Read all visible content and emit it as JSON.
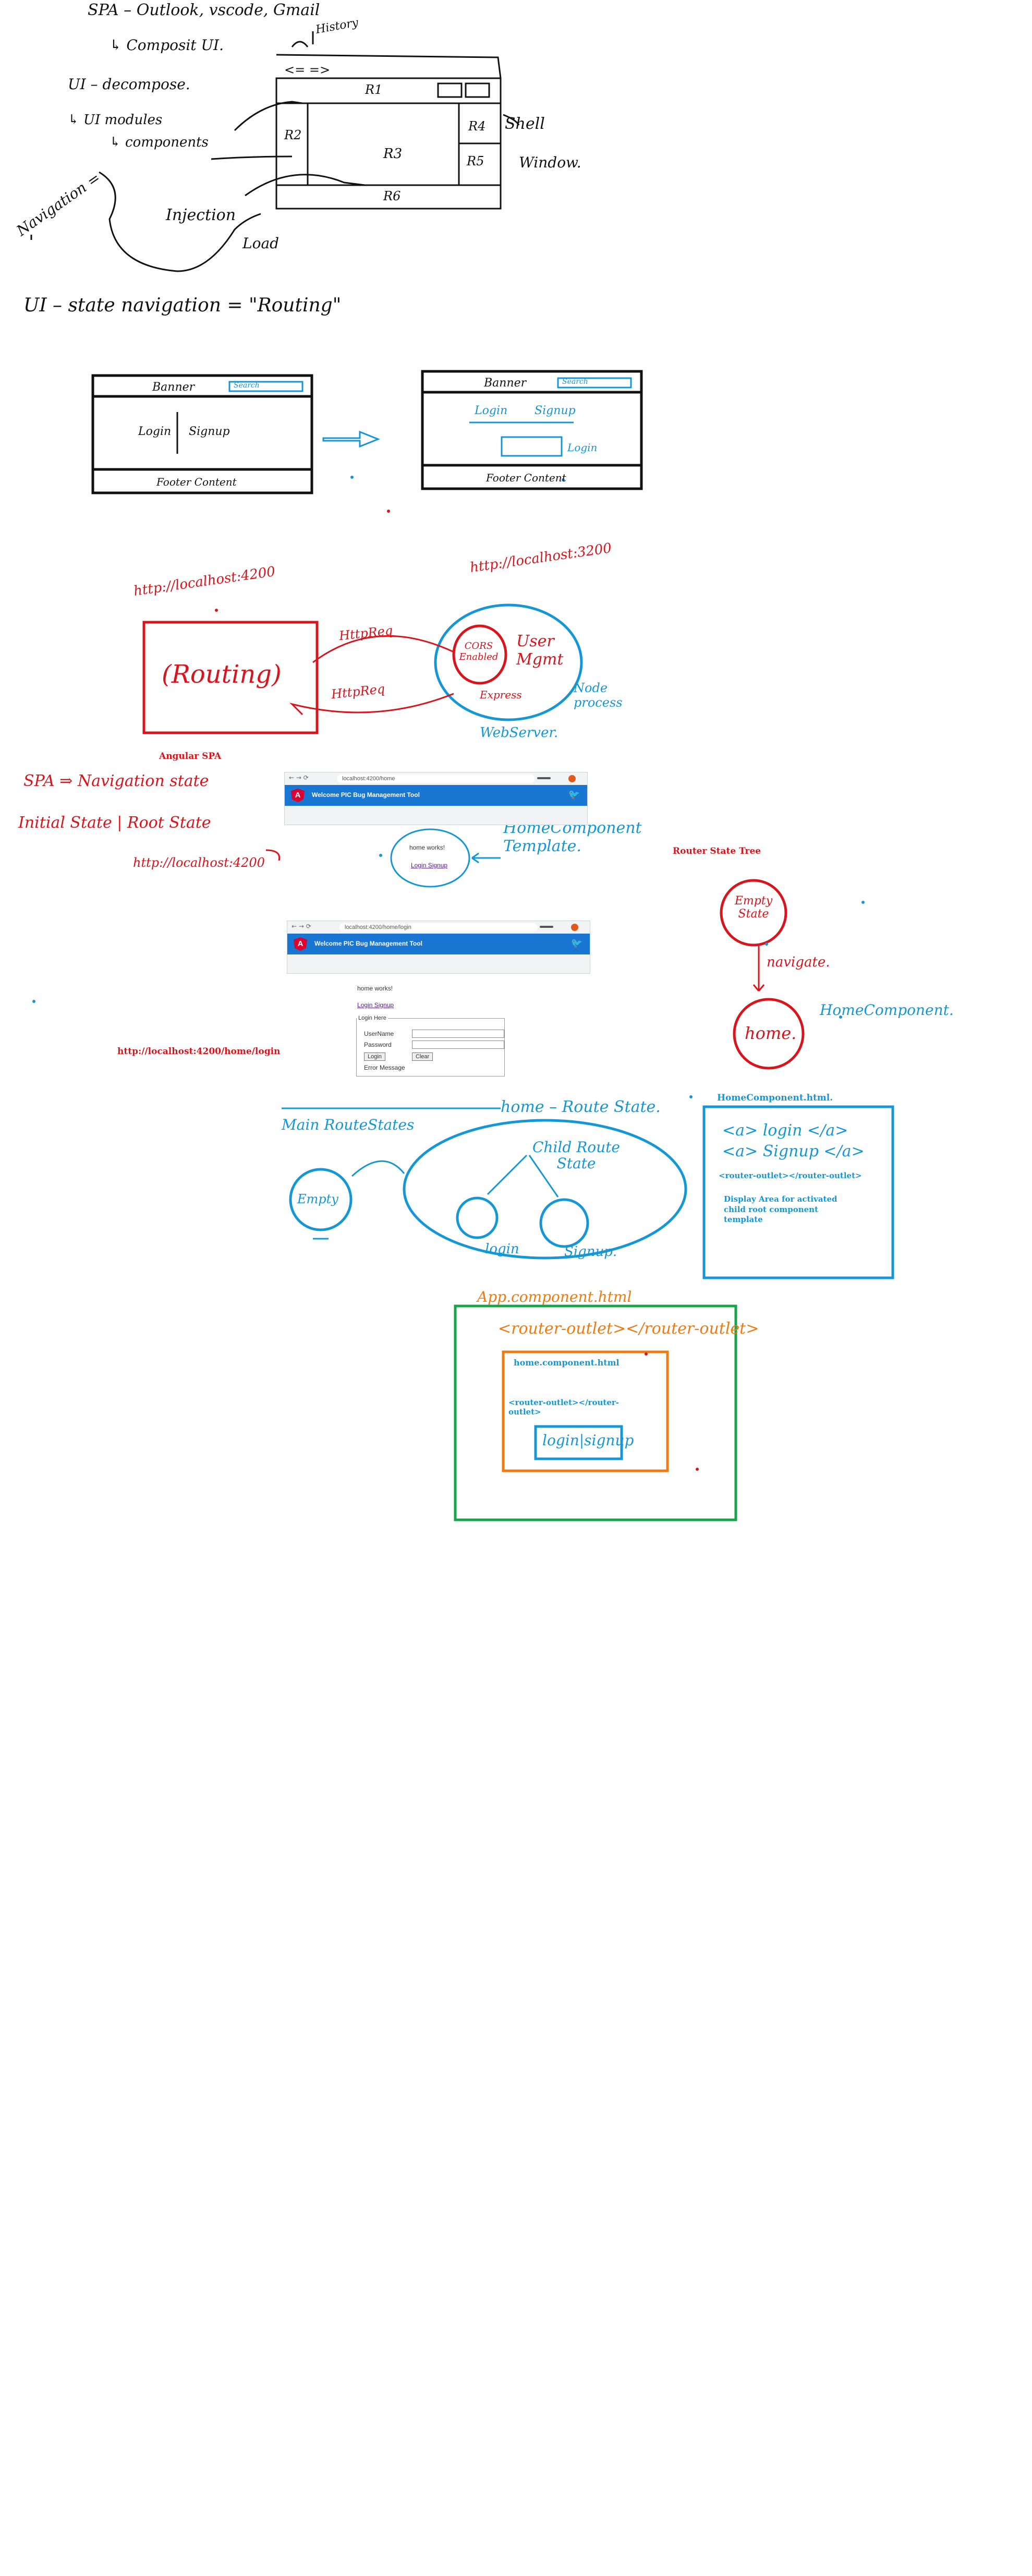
{
  "notes": {
    "spa_line": "SPA – Outlook, vscode, Gmail",
    "composite_ui": "↳ Composit UI.",
    "ui_decompose": "UI – decompose.",
    "ui_modules": "↳ UI modules",
    "components": "↳ components",
    "navigation": "Navigation =",
    "injection": "Injection",
    "load": "Load",
    "history": "History",
    "arrows": "<= =>",
    "shell": "Shell",
    "window": "Window.",
    "ui_state": "UI – state navigation = \"Routing\""
  },
  "shell_regions": {
    "r1": "R1",
    "r2": "R2",
    "r3": "R3",
    "r4": "R4",
    "r5": "R5",
    "r6": "R6"
  },
  "mockups": {
    "banner": "Banner",
    "search": "Search",
    "login": "Login",
    "signup": "Signup",
    "footer": "Footer Content"
  },
  "routing": {
    "url_left": "http://localhost:4200",
    "url_right": "http://localhost:3200",
    "routing_label": "(Routing)",
    "http_req_1": "HttpReq",
    "http_req_2": "HttpReq",
    "cors": "CORS Enabled",
    "user_mgmt": "User Mgmt",
    "express": "Express",
    "webserver": "WebServer.",
    "node": "Node process",
    "angular_spa": "Angular SPA"
  },
  "states": {
    "nav_state": "SPA ⇒ Navigation state",
    "initial_state": "Initial State | Root State",
    "url_local": "http://localhost:4200",
    "home_component_template": "HomeComponent Template.",
    "router_state_tree": "Router State Tree",
    "empty_state": "Empty State",
    "navigate": "navigate.",
    "home": "home.",
    "home_component": "HomeComponent.",
    "login_url": "http://localhost:4200/home/login"
  },
  "browser1": {
    "url": "localhost:4200/home",
    "title": "Welcome PIC Bug Management Tool",
    "home_works": "home works!",
    "links": "Login  Signup"
  },
  "browser2": {
    "url": "localhost:4200/home/login",
    "title": "Welcome PIC Bug Management Tool",
    "home_works": "home works!",
    "links": "Login  Signup",
    "login_legend": "Login Here",
    "username": "UserName",
    "password": "Password",
    "login_btn": "Login",
    "clear_btn": "Clear",
    "error": "Error Message"
  },
  "route_diagram": {
    "main_route_states": "Main RouteStates",
    "home_route_state": "home – Route State.",
    "empty": "Empty",
    "child_route_state": "Child Route State",
    "login": "login",
    "signup": "Signup."
  },
  "home_html_box": {
    "title": "HomeComponent.html.",
    "line1": "<a> login </a>",
    "line2": "<a> Signup </a>",
    "outlet": "<router-outlet></router-outlet>",
    "display": "Display Area for activated child root component template"
  },
  "app_box": {
    "title": "App.component.html",
    "outlet_line": "<router-outlet></router-outlet>",
    "home_html": "home.component.html",
    "inner_outlet": "<router-outlet></router-outlet>",
    "login_signup": "login|signup"
  },
  "colors": {
    "red": "#d8141c",
    "blue": "#1596d6",
    "green": "#19a34a",
    "orange": "#f07a12",
    "angular_blue": "#1976d2"
  }
}
